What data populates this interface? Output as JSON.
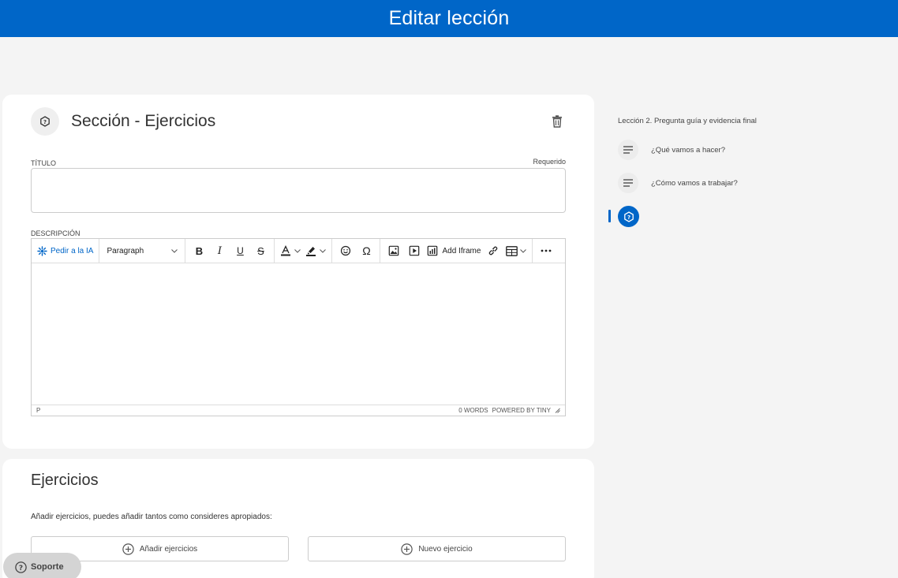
{
  "header": {
    "title": "Editar lección"
  },
  "section": {
    "icon": "question-hexagon-icon",
    "title": "Sección - Ejercicios",
    "title_label": "TÍTULO",
    "required_label": "Requerido",
    "title_value": "",
    "description_label": "DESCRIPCIÓN"
  },
  "editor": {
    "ai_label": "Pedir a la IA",
    "block_format": "Paragraph",
    "iframe_label": "Add Iframe",
    "status_path": "P",
    "word_count": "0 WORDS",
    "powered_by": "POWERED BY TINY"
  },
  "exercises": {
    "title": "Ejercicios",
    "hint": "Añadir ejercicios, puedes añadir tantos como consideres apropiados:",
    "add_label": "Añadir ejercicios",
    "new_label": "Nuevo ejercicio"
  },
  "support": {
    "label": "Soporte"
  },
  "sidebar": {
    "lesson_title": "Lección 2. Pregunta guía y evidencia final",
    "items": [
      {
        "label": "¿Qué vamos a hacer?",
        "icon": "text-lines-icon"
      },
      {
        "label": "¿Cómo vamos a trabajar?",
        "icon": "text-lines-icon"
      }
    ],
    "active_icon": "question-hexagon-icon"
  },
  "colors": {
    "brand": "#0066c8",
    "background": "#f4f4f4"
  }
}
